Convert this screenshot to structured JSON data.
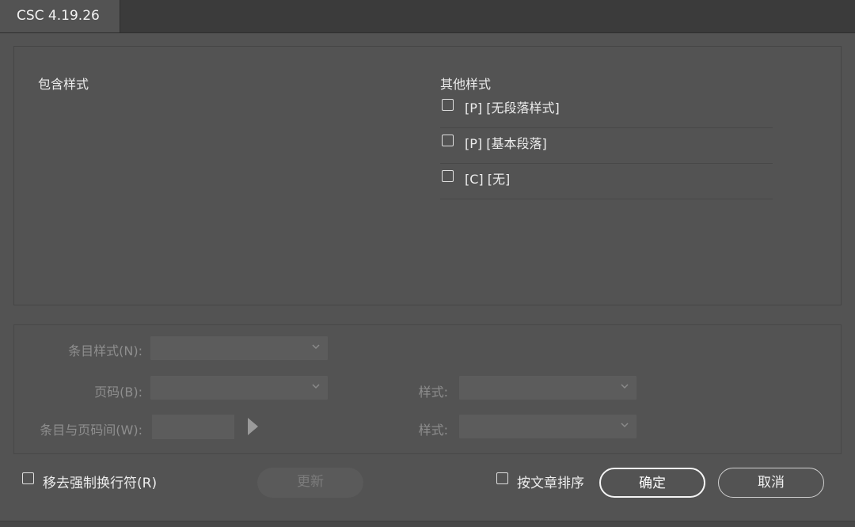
{
  "window": {
    "tab_title": "CSC 4.19.26"
  },
  "styles": {
    "included_heading": "包含样式",
    "other_heading": "其他样式",
    "other_items": [
      {
        "label": "[P] [无段落样式]",
        "checked": false
      },
      {
        "label": "[P] [基本段落]",
        "checked": false
      },
      {
        "label": "[C] [无]",
        "checked": false
      }
    ]
  },
  "options": {
    "entry_style_label": "条目样式(N):",
    "entry_style_value": "",
    "page_number_label": "页码(B):",
    "page_number_value": "",
    "page_style_label": "样式:",
    "page_style_value": "",
    "between_label": "条目与页码间(W):",
    "between_value": "",
    "between_style_label": "样式:",
    "between_style_value": ""
  },
  "footer": {
    "remove_breaks_label": "移去强制换行符(R)",
    "remove_breaks_checked": false,
    "update_button": "更新",
    "sort_label": "按文章排序",
    "sort_checked": false,
    "ok_button": "确定",
    "cancel_button": "取消"
  },
  "icons": {
    "dropdown": "chevron-down-icon",
    "insert_menu": "triangle-right-icon"
  },
  "colors": {
    "background": "#535353",
    "tab_bar": "#3b3b3b",
    "disabled_text": "#8e8e8e"
  }
}
